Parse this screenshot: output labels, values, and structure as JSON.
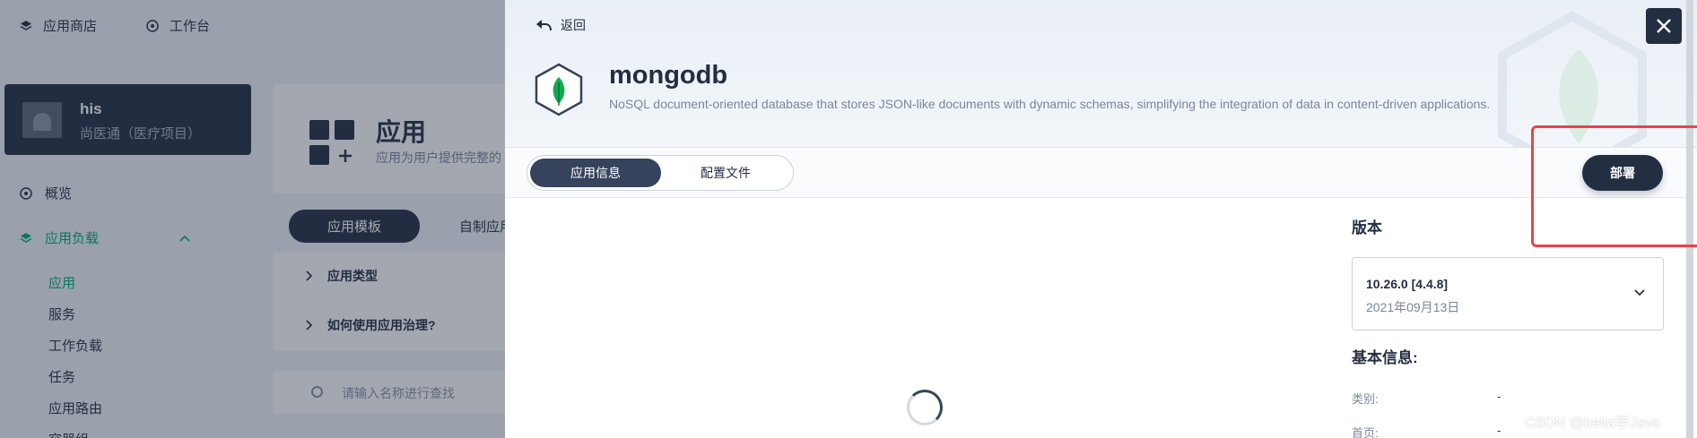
{
  "topnav": {
    "items": [
      {
        "label": "应用商店",
        "icon": "store-icon"
      },
      {
        "label": "工作台",
        "icon": "workbench-icon"
      }
    ]
  },
  "workspace": {
    "name": "his",
    "description": "尚医通（医疗项目）"
  },
  "sidebar": {
    "overview": "概览",
    "workloads_group": "应用负载",
    "items": [
      "应用",
      "服务",
      "工作负载",
      "任务",
      "应用路由",
      "容器组"
    ]
  },
  "apps_page": {
    "title": "应用",
    "description": "应用为用户提供完整的",
    "tabs": {
      "active": "应用模板",
      "other": "自制应用"
    },
    "faq": [
      "应用类型",
      "如何使用应用治理?"
    ],
    "search_placeholder": "请输入名称进行查找"
  },
  "drawer": {
    "back_label": "返回",
    "app_name": "mongodb",
    "app_description": "NoSQL document-oriented database that stores JSON-like documents with dynamic schemas, simplifying the integration of data in content-driven applications.",
    "tabs": {
      "info": "应用信息",
      "config": "配置文件"
    },
    "deploy_label": "部署",
    "version_section": "版本",
    "version": {
      "value": "10.26.0 [4.4.8]",
      "date": "2021年09月13日"
    },
    "basic_info_title": "基本信息:",
    "basic_info": [
      {
        "key": "类别:",
        "value": "-"
      },
      {
        "key": "首页:",
        "value": "-"
      }
    ]
  },
  "watermark": "CSDN @beita学Java",
  "colors": {
    "brand_dark": "#242e42",
    "accent_green": "#00aa72",
    "highlight_red": "#e84545",
    "mongodb_leaf": "#13aa52"
  }
}
